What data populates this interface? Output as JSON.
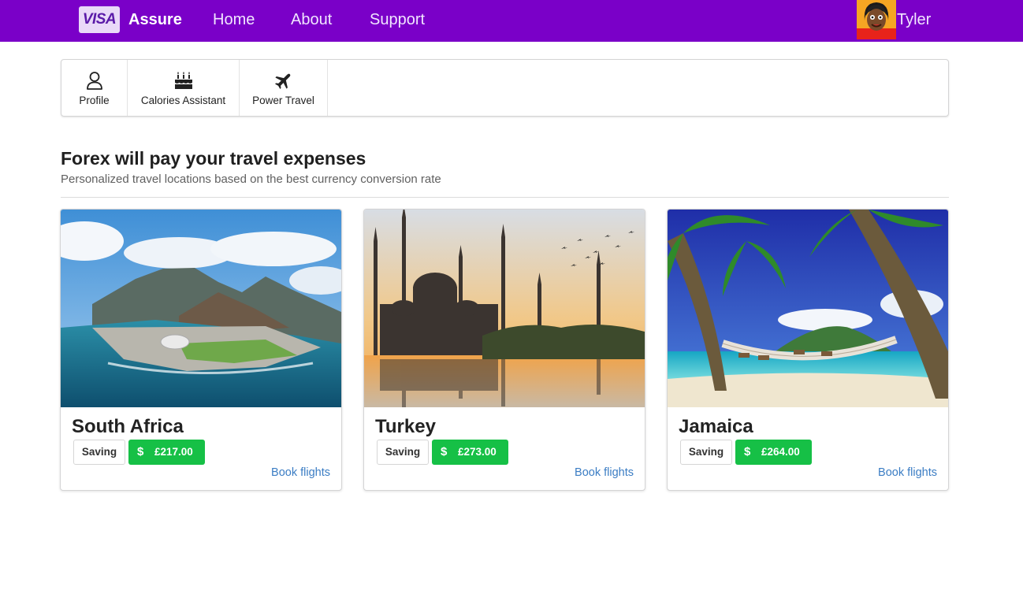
{
  "nav": {
    "logo_text": "VISA",
    "brand": "Assure",
    "links": [
      "Home",
      "About",
      "Support"
    ],
    "user": "Tyler"
  },
  "menu": {
    "items": [
      {
        "label": "Profile",
        "icon": "user-icon"
      },
      {
        "label": "Calories Assistant",
        "icon": "birthday-cake-icon"
      },
      {
        "label": "Power Travel",
        "icon": "plane-icon"
      }
    ]
  },
  "section": {
    "title": "Forex will pay your travel expenses",
    "subtitle": "Personalized travel locations based on the best currency conversion rate"
  },
  "cards": [
    {
      "title": "South Africa",
      "saving_label": "Saving",
      "currency_icon": "$",
      "amount": "£217.00",
      "link": "Book flights"
    },
    {
      "title": "Turkey",
      "saving_label": "Saving",
      "currency_icon": "$",
      "amount": "£273.00",
      "link": "Book flights"
    },
    {
      "title": "Jamaica",
      "saving_label": "Saving",
      "currency_icon": "$",
      "amount": "£264.00",
      "link": "Book flights"
    }
  ],
  "colors": {
    "nav_bg": "#7a00c8",
    "saving_green": "#16c046",
    "link_blue": "#3b7dc4"
  }
}
